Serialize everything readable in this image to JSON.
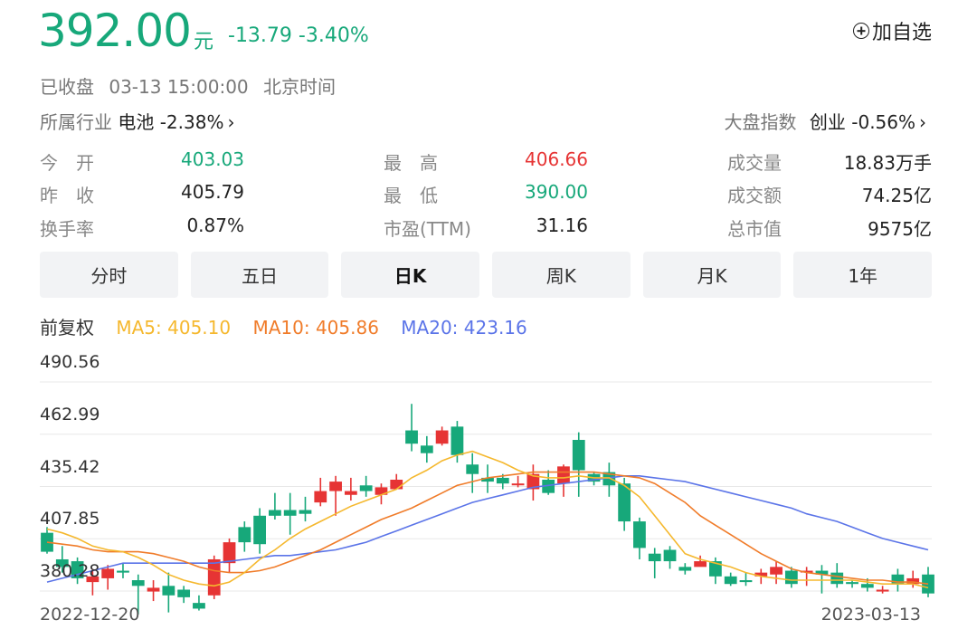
{
  "quote": {
    "price": "392.00",
    "unit": "元",
    "change": "-13.79",
    "change_pct": "-3.40%",
    "add_favorite": "加自选",
    "status": "已收盘",
    "time": "03-13 15:00:00",
    "timezone": "北京时间",
    "industry_label": "所属行业",
    "industry_value": "电池 -2.38%",
    "index_label": "大盘指数",
    "index_value": "创业 -0.56%"
  },
  "stats": [
    {
      "label": "今　开",
      "value": "403.03",
      "color": "#17a87a"
    },
    {
      "label": "最　高",
      "value": "406.66",
      "color": "#e63434"
    },
    {
      "label": "成交量",
      "value": "18.83万手",
      "color": "#222222"
    },
    {
      "label": "昨　收",
      "value": "405.79",
      "color": "#222222"
    },
    {
      "label": "最　低",
      "value": "390.00",
      "color": "#17a87a"
    },
    {
      "label": "成交额",
      "value": "74.25亿",
      "color": "#222222"
    },
    {
      "label": "换手率",
      "value": "0.87%",
      "color": "#222222"
    },
    {
      "label": "市盈(TTM)",
      "value": "31.16",
      "color": "#222222"
    },
    {
      "label": "总市值",
      "value": "9575亿",
      "color": "#222222"
    }
  ],
  "tabs": [
    "分时",
    "五日",
    "日K",
    "周K",
    "月K",
    "1年"
  ],
  "active_tab": "日K",
  "indicators": {
    "adjust": "前复权",
    "ma5": "MA5: 405.10",
    "ma10": "MA10: 405.86",
    "ma20": "MA20: 423.16"
  },
  "colors": {
    "up": "#e63434",
    "down": "#17a87a",
    "ma5": "#f5b82e",
    "ma10": "#f07c2a",
    "ma20": "#5b74e8"
  },
  "chart_data": {
    "type": "candlestick",
    "y_ticks": [
      "490.56",
      "462.99",
      "435.42",
      "407.85",
      "380.28"
    ],
    "ylim": [
      380.28,
      490.56
    ],
    "x_start_label": "2022-12-20",
    "x_end_label": "2023-03-13",
    "candles": [
      [
        411,
        401,
        414,
        400
      ],
      [
        397,
        393,
        404,
        390
      ],
      [
        396,
        387,
        398,
        384
      ],
      [
        385,
        388,
        392,
        378
      ],
      [
        387,
        392,
        394,
        381
      ],
      [
        391,
        390,
        395,
        387
      ],
      [
        386,
        383,
        389,
        368
      ],
      [
        380,
        382,
        386,
        375
      ],
      [
        383,
        378,
        390,
        369
      ],
      [
        381,
        377,
        383,
        374
      ],
      [
        374,
        371,
        378,
        370
      ],
      [
        378,
        397,
        399,
        376
      ],
      [
        395,
        406,
        408,
        390
      ],
      [
        414,
        406,
        417,
        401
      ],
      [
        420,
        405,
        424,
        400
      ],
      [
        423,
        420,
        432,
        418
      ],
      [
        423,
        420,
        432,
        410
      ],
      [
        423,
        421,
        430,
        417
      ],
      [
        427,
        433,
        440,
        425
      ],
      [
        433,
        438,
        441,
        420
      ],
      [
        431,
        433,
        440,
        428
      ],
      [
        436,
        433,
        441,
        430
      ],
      [
        431,
        435,
        437,
        426
      ],
      [
        434,
        439,
        442,
        434
      ],
      [
        465,
        458,
        479,
        454
      ],
      [
        457,
        453,
        462,
        448
      ],
      [
        458,
        465,
        467,
        457
      ],
      [
        467,
        452,
        470,
        448
      ],
      [
        447,
        442,
        453,
        432
      ],
      [
        440,
        438,
        447,
        432
      ],
      [
        440,
        437,
        442,
        434
      ],
      [
        437,
        437,
        441,
        435
      ],
      [
        434,
        442,
        447,
        428
      ],
      [
        439,
        432,
        444,
        431
      ],
      [
        437,
        446,
        447,
        430
      ],
      [
        460,
        444,
        464,
        430
      ],
      [
        442,
        438,
        443,
        436
      ],
      [
        443,
        436,
        448,
        430
      ],
      [
        437,
        417,
        440,
        412
      ],
      [
        417,
        403,
        419,
        397
      ],
      [
        400,
        396,
        403,
        387
      ],
      [
        402,
        396,
        404,
        392
      ],
      [
        393,
        391,
        395,
        389
      ],
      [
        393,
        396,
        399,
        394
      ],
      [
        396,
        388,
        398,
        384
      ],
      [
        388,
        384,
        390,
        383
      ],
      [
        386,
        385,
        390,
        383
      ],
      [
        388,
        390,
        392,
        384
      ],
      [
        389,
        393,
        396,
        384
      ],
      [
        391,
        384,
        393,
        382
      ],
      [
        391,
        391,
        393,
        383
      ],
      [
        391,
        389,
        394,
        379
      ],
      [
        390,
        384,
        395,
        382
      ],
      [
        385,
        384,
        386,
        382
      ],
      [
        384,
        382,
        387,
        380
      ],
      [
        380,
        381,
        383,
        379
      ],
      [
        389,
        384,
        392,
        380
      ],
      [
        384,
        387,
        391,
        382
      ],
      [
        389,
        379,
        393,
        377
      ]
    ],
    "ma5": [
      413,
      411,
      408,
      404,
      402,
      401,
      398,
      394,
      389,
      386,
      384,
      383,
      385,
      390,
      397,
      402,
      408,
      413,
      417,
      421,
      425,
      428,
      431,
      434,
      440,
      444,
      449,
      452,
      454,
      451,
      448,
      444,
      441,
      440,
      440,
      441,
      440,
      440,
      436,
      430,
      420,
      410,
      400,
      397,
      395,
      393,
      390,
      388,
      387,
      386,
      386,
      386,
      386,
      386,
      385,
      384,
      384,
      384,
      382
    ],
    "ma10": [
      406,
      405,
      404,
      402,
      401,
      401,
      401,
      400,
      398,
      396,
      393,
      391,
      390,
      390,
      391,
      393,
      396,
      399,
      402,
      406,
      410,
      414,
      418,
      421,
      424,
      428,
      432,
      436,
      438,
      440,
      441,
      442,
      443,
      443,
      443,
      443,
      443,
      442,
      441,
      440,
      437,
      432,
      427,
      420,
      415,
      410,
      405,
      400,
      396,
      392,
      390,
      389,
      388,
      387,
      386,
      386,
      385,
      385,
      384
    ],
    "ma20": [
      385,
      387,
      389,
      391,
      393,
      395,
      395,
      395,
      395,
      395,
      395,
      395,
      396,
      397,
      398,
      399,
      399,
      400,
      401,
      402,
      404,
      406,
      409,
      412,
      415,
      418,
      421,
      424,
      427,
      429,
      431,
      433,
      435,
      436,
      437,
      438,
      439,
      440,
      441,
      441,
      440,
      439,
      438,
      436,
      434,
      432,
      430,
      428,
      426,
      424,
      421,
      419,
      417,
      414,
      411,
      408,
      406,
      404,
      402
    ]
  }
}
